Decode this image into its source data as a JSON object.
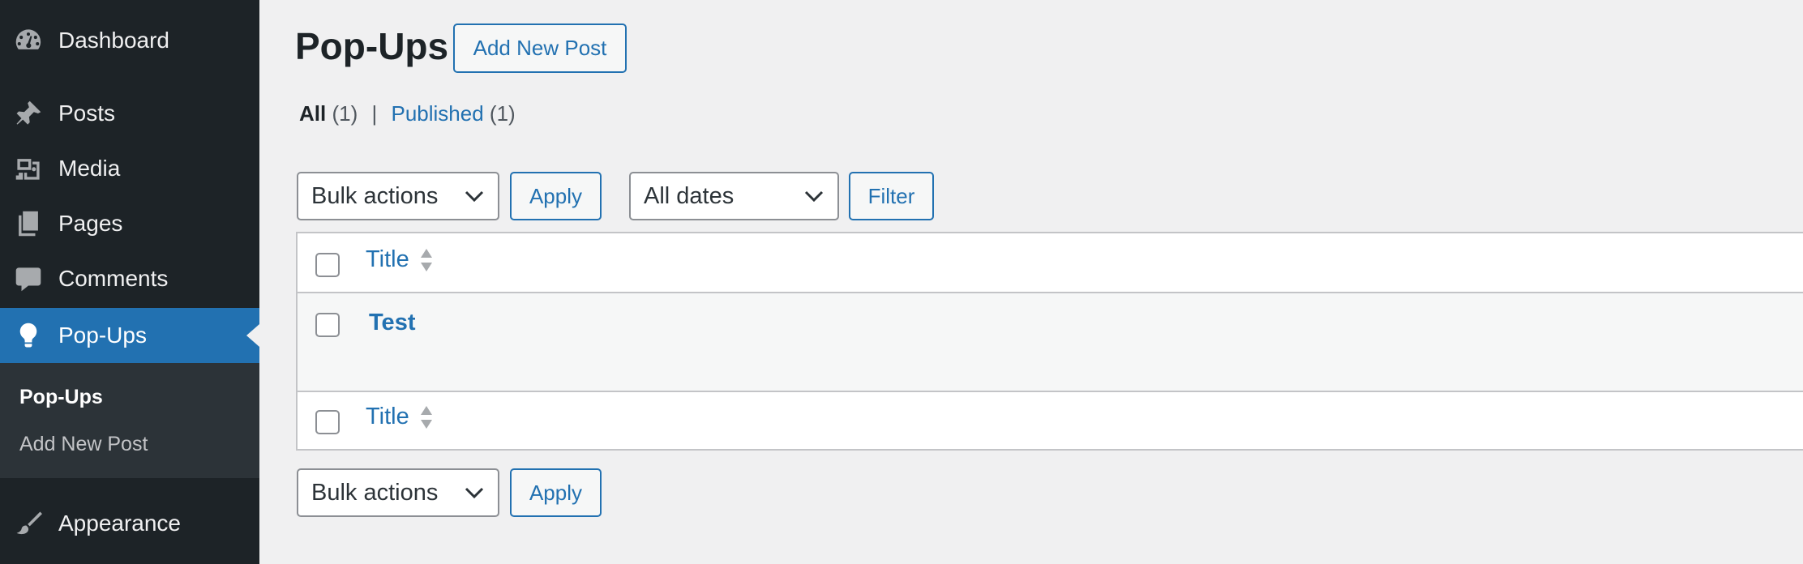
{
  "sidebar": {
    "items": [
      {
        "label": "Dashboard",
        "icon": "dashboard-icon"
      },
      {
        "label": "Posts",
        "icon": "pin-icon"
      },
      {
        "label": "Media",
        "icon": "media-icon"
      },
      {
        "label": "Pages",
        "icon": "pages-icon"
      },
      {
        "label": "Comments",
        "icon": "comment-icon"
      },
      {
        "label": "Pop-Ups",
        "icon": "lightbulb-icon",
        "active": true
      },
      {
        "label": "Appearance",
        "icon": "paintbrush-icon"
      }
    ],
    "submenu": [
      {
        "label": "Pop-Ups",
        "current": true
      },
      {
        "label": "Add New Post"
      }
    ]
  },
  "page": {
    "title": "Pop-Ups",
    "add_new_label": "Add New Post"
  },
  "views": {
    "all_label": "All",
    "all_count": "(1)",
    "separator": "|",
    "published_label": "Published",
    "published_count": "(1)"
  },
  "tablenav_top": {
    "bulk_actions": "Bulk actions",
    "apply_label": "Apply",
    "dates": "All dates",
    "filter_label": "Filter"
  },
  "table": {
    "column_title": "Title",
    "rows": [
      {
        "title": "Test"
      }
    ]
  },
  "tablenav_bottom": {
    "bulk_actions": "Bulk actions",
    "apply_label": "Apply"
  },
  "colors": {
    "sidebar_bg": "#1d2327",
    "accent": "#2271b1",
    "page_bg": "#f0f0f1"
  }
}
